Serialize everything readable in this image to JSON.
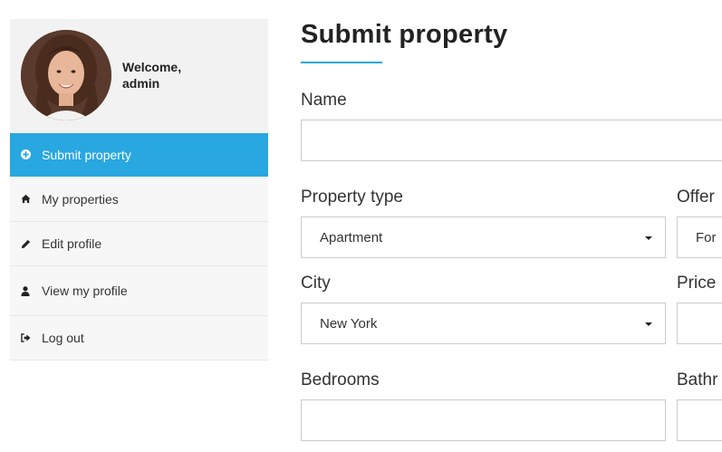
{
  "sidebar": {
    "welcome_line1": "Welcome,",
    "welcome_line2": "admin",
    "items": [
      {
        "label": "Submit property",
        "icon": "plus-circle-icon",
        "active": true
      },
      {
        "label": "My properties",
        "icon": "home-icon",
        "active": false
      },
      {
        "label": "Edit profile",
        "icon": "pencil-icon",
        "active": false
      },
      {
        "label": "View my profile",
        "icon": "user-icon",
        "active": false
      },
      {
        "label": "Log out",
        "icon": "sign-out-icon",
        "active": false
      }
    ]
  },
  "main": {
    "title": "Submit property",
    "fields": {
      "name": {
        "label": "Name",
        "value": ""
      },
      "property_type": {
        "label": "Property type",
        "value": "Apartment"
      },
      "offer": {
        "label": "Offer",
        "value": "For"
      },
      "city": {
        "label": "City",
        "value": "New York"
      },
      "price": {
        "label": "Price",
        "value": ""
      },
      "bedrooms": {
        "label": "Bedrooms",
        "value": ""
      },
      "bathrooms": {
        "label": "Bathr",
        "value": ""
      }
    }
  },
  "colors": {
    "accent": "#29a7e1",
    "sidebar_bg": "#f7f7f7",
    "profile_bg": "#f2f2f2",
    "border": "#cccccc"
  }
}
